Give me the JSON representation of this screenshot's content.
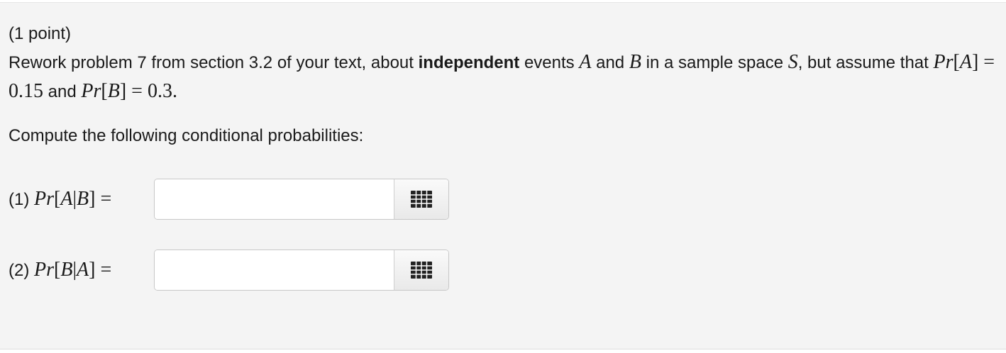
{
  "problem": {
    "points_label": "(1 point)",
    "statement": {
      "t1": "Rework problem 7 from section 3.2 of your text, about ",
      "bold": "independent",
      "t2": " events ",
      "var_A": "A",
      "t3": " and ",
      "var_B": "B",
      "t4": " in a sample space ",
      "var_S": "S",
      "t5": ", but assume that ",
      "m1_pr": "Pr",
      "m1_open": "[",
      "m1_var": "A",
      "m1_close": "] = 0.15",
      "t6": " and ",
      "m2_pr": "Pr",
      "m2_open": "[",
      "m2_var": "B",
      "m2_close": "] = 0.3."
    },
    "prompt": "Compute the following conditional probabilities:"
  },
  "answers": [
    {
      "label_prefix": "(1) ",
      "pr": "Pr",
      "open": "[",
      "v1": "A",
      "bar": "|",
      "v2": "B",
      "close": "] =",
      "value": "",
      "palette_icon": "equation-palette-icon"
    },
    {
      "label_prefix": "(2) ",
      "pr": "Pr",
      "open": "[",
      "v1": "B",
      "bar": "|",
      "v2": "A",
      "close": "] =",
      "value": "",
      "palette_icon": "equation-palette-icon"
    }
  ]
}
